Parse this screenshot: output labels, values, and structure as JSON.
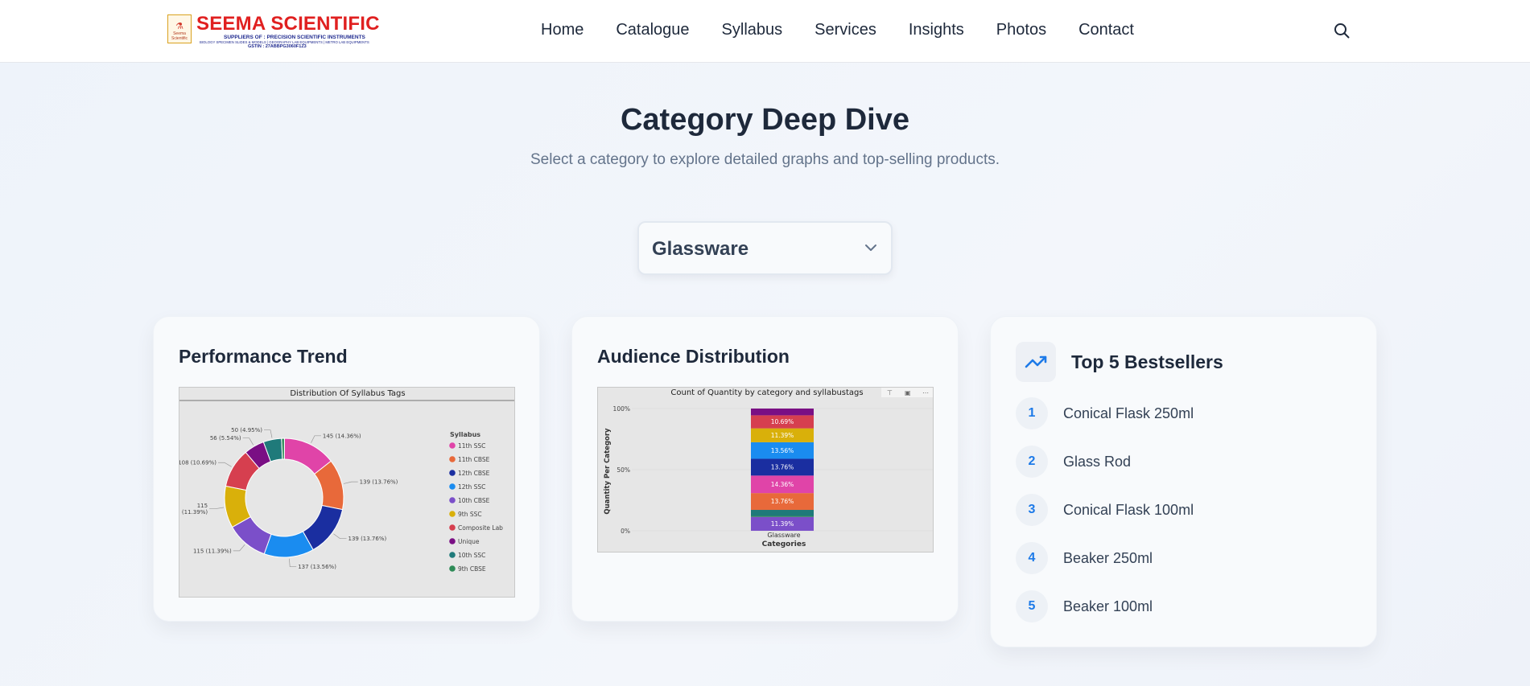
{
  "brand": {
    "name": "SEEMA SCIENTIFIC",
    "tagline": "SUPPLIERS OF : PRECISION SCIENTIFIC INSTRUMENTS",
    "sub_tagline": "BIOLOGY SPECIMEN SLIDES & MODELS | GEOGRAPHY LAB EQUIPMENTS | METRO LAB EQUIPMENTS",
    "gstin": "GSTIN : 27ABBPG3060F1Z3",
    "badge_text": "Seema Scientific"
  },
  "nav": {
    "items": [
      "Home",
      "Catalogue",
      "Syllabus",
      "Services",
      "Insights",
      "Photos",
      "Contact"
    ],
    "search_icon": "search-icon"
  },
  "hero": {
    "title": "Category Deep Dive",
    "subtitle": "Select a category to explore detailed graphs and top-selling products."
  },
  "category_select": {
    "value": "Glassware",
    "icon": "chevron-down-icon"
  },
  "performance": {
    "title": "Performance Trend"
  },
  "audience": {
    "title": "Audience Distribution"
  },
  "bestsellers": {
    "title": "Top 5 Bestsellers",
    "icon": "trending-up-icon",
    "items": [
      {
        "rank": "1",
        "name": "Conical Flask 250ml"
      },
      {
        "rank": "2",
        "name": "Glass Rod"
      },
      {
        "rank": "3",
        "name": "Conical Flask 100ml"
      },
      {
        "rank": "4",
        "name": "Beaker 250ml"
      },
      {
        "rank": "5",
        "name": "Beaker 100ml"
      }
    ]
  },
  "chart_data": [
    {
      "type": "pie",
      "title": "Distribution Of Syllabus Tags",
      "legend_title": "Syllabus",
      "legend_position": "right",
      "categories": [
        "11th SSC",
        "11th CBSE",
        "12th CBSE",
        "12th SSC",
        "10th CBSE",
        "9th SSC",
        "Composite Lab",
        "Unique",
        "10th SSC",
        "9th CBSE"
      ],
      "values": [
        145,
        139,
        139,
        137,
        115,
        115,
        108,
        56,
        50,
        8
      ],
      "labels": [
        "145 (14.36%)",
        "139 (13.76%)",
        "139 (13.76%)",
        "137 (13.56%)",
        "115 (11.39%)",
        "115\n(11.39%)",
        "108 (10.69%)",
        "56 (5.54%)",
        "50 (4.95%)",
        ""
      ],
      "colors": [
        "#e044a8",
        "#e8693a",
        "#1a2ea0",
        "#1a8cf0",
        "#7b4fc9",
        "#d9b00a",
        "#d63f4f",
        "#7a0f84",
        "#1f7a7a",
        "#2e8b57"
      ]
    },
    {
      "type": "bar",
      "title": "Count of Quantity by category and syllabustags",
      "xlabel": "Categories",
      "ylabel": "Quantity Per Category",
      "categories": [
        "Glassware"
      ],
      "y_ticks": [
        "0%",
        "50%",
        "100%"
      ],
      "series": [
        {
          "label": "11.39%",
          "percent": 11.39,
          "color": "#7b4fc9"
        },
        {
          "label": "",
          "percent": 0.79,
          "color": "#2e8b57"
        },
        {
          "label": "",
          "percent": 4.95,
          "color": "#1f7a7a"
        },
        {
          "label": "13.76%",
          "percent": 13.76,
          "color": "#e8693a"
        },
        {
          "label": "14.36%",
          "percent": 14.36,
          "color": "#e044a8"
        },
        {
          "label": "13.76%",
          "percent": 13.76,
          "color": "#1a2ea0"
        },
        {
          "label": "13.56%",
          "percent": 13.56,
          "color": "#1a8cf0"
        },
        {
          "label": "11.39%",
          "percent": 11.39,
          "color": "#d9b00a"
        },
        {
          "label": "10.69%",
          "percent": 10.69,
          "color": "#d63f4f"
        },
        {
          "label": "",
          "percent": 5.54,
          "color": "#7a0f84"
        }
      ]
    }
  ]
}
